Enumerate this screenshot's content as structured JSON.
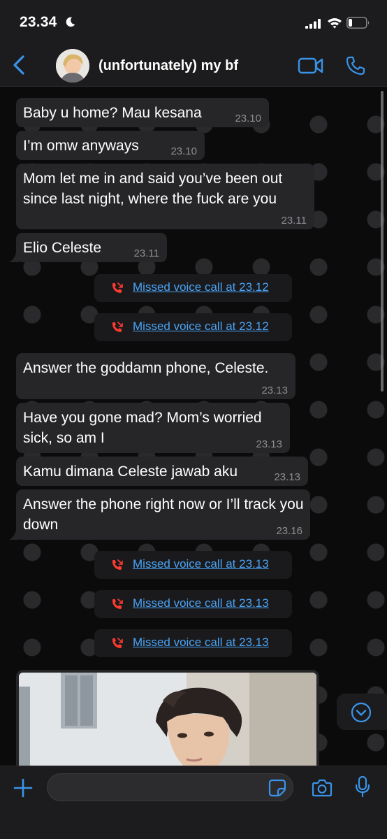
{
  "status_bar": {
    "time": "23.34"
  },
  "header": {
    "chat_name": "(unfortunately) my bf"
  },
  "messages": [
    {
      "text": "Baby u home? Mau kesana",
      "time": "23.10"
    },
    {
      "text": "I’m omw anyways",
      "time": "23.10"
    },
    {
      "text": "Mom let me in and said you’ve been out since last night, where the fuck are you",
      "time": "23.11"
    },
    {
      "text": "Elio Celeste",
      "time": "23.11"
    },
    {
      "text": "Answer the goddamn phone, Celeste.",
      "time": "23.13"
    },
    {
      "text": "Have you gone mad? Mom’s worried sick, so am I",
      "time": "23.13"
    },
    {
      "text": "Kamu dimana Celeste jawab aku",
      "time": "23.13"
    },
    {
      "text": "Answer the phone right now or I’ll track you down",
      "time": "23.16"
    }
  ],
  "missed_calls": [
    {
      "text": "Missed voice call at 23.12"
    },
    {
      "text": "Missed voice call at 23.12"
    },
    {
      "text": "Missed voice call at 23.13"
    },
    {
      "text": "Missed voice call at 23.13"
    },
    {
      "text": "Missed voice call at 23.13"
    }
  ],
  "composer": {
    "placeholder": ""
  },
  "icons": {
    "back": "chevron-left-icon",
    "video": "video-camera-icon",
    "call": "phone-icon",
    "missed_call": "missed-call-icon",
    "scroll_down": "chevron-down-icon",
    "add": "plus-icon",
    "sticker": "sticker-icon",
    "camera": "camera-icon",
    "mic": "microphone-icon"
  },
  "colors": {
    "accent": "#3a93e8",
    "missed_call": "#ff3b30",
    "bubble": "#262628",
    "background": "#0b0b0c"
  }
}
